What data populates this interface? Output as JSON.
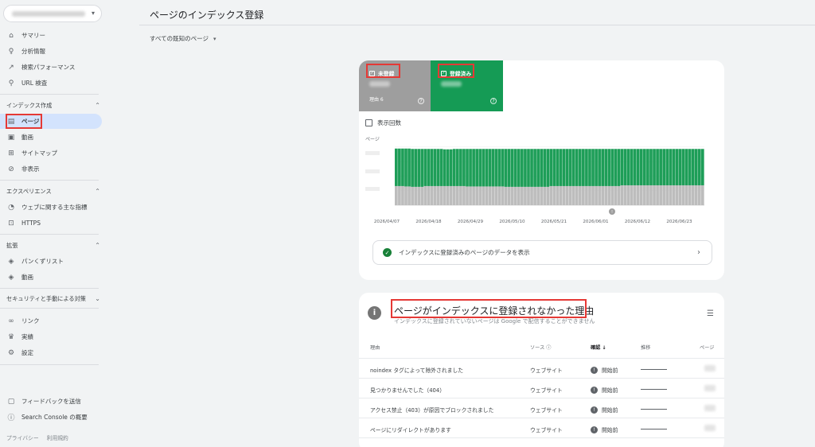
{
  "sidebar": {
    "property_label": "",
    "items_top": [
      {
        "icon": "home-icon",
        "glyph": "⌂",
        "label": "サマリー"
      },
      {
        "icon": "bulb-icon",
        "glyph": "♀",
        "label": "分析情報"
      },
      {
        "icon": "trending-icon",
        "glyph": "↗",
        "label": "検索パフォーマンス"
      },
      {
        "icon": "search-icon",
        "glyph": "⚲",
        "label": "URL 検査"
      }
    ],
    "section_index": {
      "label": "インデックス作成"
    },
    "items_index": [
      {
        "icon": "page-icon",
        "glyph": "▤",
        "label": "ページ",
        "active": true
      },
      {
        "icon": "video-icon",
        "glyph": "▣",
        "label": "動画"
      },
      {
        "icon": "sitemap-icon",
        "glyph": "⊞",
        "label": "サイトマップ"
      },
      {
        "icon": "hidden-icon",
        "glyph": "⊘",
        "label": "非表示"
      }
    ],
    "section_experience": {
      "label": "エクスペリエンス"
    },
    "items_experience": [
      {
        "icon": "gauge-icon",
        "glyph": "◔",
        "label": "ウェブに関する主な指標"
      },
      {
        "icon": "lock-icon",
        "glyph": "⊡",
        "label": "HTTPS"
      }
    ],
    "section_enhance": {
      "label": "拡張"
    },
    "items_enhance": [
      {
        "icon": "layers-icon",
        "glyph": "◈",
        "label": "パンくずリスト"
      },
      {
        "icon": "layers-icon",
        "glyph": "◈",
        "label": "動画"
      }
    ],
    "section_security": {
      "label": "セキュリティと手動による対策"
    },
    "items_misc": [
      {
        "icon": "link-icon",
        "glyph": "∞",
        "label": "リンク"
      },
      {
        "icon": "trophy-icon",
        "glyph": "♛",
        "label": "実績"
      },
      {
        "icon": "gear-icon",
        "glyph": "⚙",
        "label": "設定"
      }
    ],
    "items_bottom": [
      {
        "icon": "feedback-icon",
        "glyph": "▢",
        "label": "フィードバックを送信"
      },
      {
        "icon": "info-icon",
        "glyph": "ⓘ",
        "label": "Search Console の概要"
      }
    ],
    "footer": {
      "privacy": "プライバシー",
      "terms": "利用規約"
    }
  },
  "header": {
    "title": "ページのインデックス登録",
    "filter": "すべての既知のページ"
  },
  "summary": {
    "not_indexed": {
      "label": "未登録",
      "reasons": "理由 6"
    },
    "indexed": {
      "label": "登録済み"
    },
    "impressions_label": "表示回数",
    "chart_ylabel": "ページ",
    "view_indexed": "インデックスに登録済みのページのデータを表示"
  },
  "chart_data": {
    "type": "bar",
    "stacked": true,
    "x": [
      "2026/04/07",
      "2026/04/18",
      "2026/04/29",
      "2026/05/10",
      "2026/05/21",
      "2026/06/01",
      "2026/06/12",
      "2026/06/23"
    ],
    "xlabel": "",
    "ylabel": "ページ",
    "series": [
      {
        "name": "未登録",
        "color": "#bdbdbd",
        "values": [
          0.5,
          0.5,
          0.5,
          0.49,
          0.49,
          0.48,
          0.48,
          0.48,
          0.48,
          0.5,
          0.5,
          0.5,
          0.5,
          0.5,
          0.5,
          0.5,
          0.5,
          0.5,
          0.5,
          0.5,
          0.5,
          0.5,
          0.49,
          0.49,
          0.49,
          0.49,
          0.49,
          0.49,
          0.49,
          0.49,
          0.49,
          0.49,
          0.49,
          0.49,
          0.48,
          0.48,
          0.48,
          0.48,
          0.48,
          0.48,
          0.48,
          0.48,
          0.48,
          0.48,
          0.48,
          0.48,
          0.48,
          0.48,
          0.5,
          0.5,
          0.5,
          0.5,
          0.5,
          0.5,
          0.5,
          0.5,
          0.5,
          0.5,
          0.5,
          0.5,
          0.5,
          0.5,
          0.5,
          0.5,
          0.5,
          0.5,
          0.5,
          0.5,
          0.5,
          0.5,
          0.52,
          0.52,
          0.52,
          0.52,
          0.52,
          0.52,
          0.52,
          0.52,
          0.52,
          0.52,
          0.52,
          0.52,
          0.52,
          0.52,
          0.52,
          0.52,
          0.52,
          0.52,
          0.52,
          0.52,
          0.52,
          0.52,
          0.52,
          0.52,
          0.52,
          0.52
        ]
      },
      {
        "name": "登録済み",
        "color": "#1e9e58",
        "values": [
          0.98,
          0.98,
          0.98,
          0.99,
          0.99,
          0.99,
          0.99,
          0.99,
          0.99,
          0.97,
          0.97,
          0.97,
          0.97,
          0.97,
          0.97,
          0.96,
          0.96,
          0.96,
          0.97,
          0.97,
          0.97,
          0.97,
          0.98,
          0.98,
          0.98,
          0.98,
          0.98,
          0.98,
          0.98,
          0.98,
          0.98,
          0.98,
          0.98,
          0.98,
          0.99,
          0.99,
          0.99,
          0.99,
          0.99,
          0.99,
          0.99,
          0.99,
          0.99,
          0.99,
          0.99,
          0.99,
          0.99,
          0.99,
          0.97,
          0.97,
          0.97,
          0.97,
          0.97,
          0.97,
          0.97,
          0.97,
          0.97,
          0.97,
          0.97,
          0.97,
          0.97,
          0.97,
          0.97,
          0.97,
          0.97,
          0.97,
          0.97,
          0.97,
          0.97,
          0.97,
          0.95,
          0.95,
          0.95,
          0.95,
          0.95,
          0.95,
          0.95,
          0.95,
          0.95,
          0.95,
          0.95,
          0.95,
          0.95,
          0.95,
          0.95,
          0.95,
          0.95,
          0.95,
          0.95,
          0.95,
          0.95,
          0.95,
          0.95,
          0.95,
          0.95,
          0.95
        ]
      }
    ],
    "grid": true
  },
  "reasons": {
    "title": "ページがインデックスに登録されなかった理由",
    "subtitle": "インデックスに登録されていないページは Google で配信することができません",
    "headers": {
      "reason": "理由",
      "source": "ソース",
      "validation": "確認",
      "trend": "推移",
      "pages": "ページ"
    },
    "rows": [
      {
        "reason": "noindex タグによって除外されました",
        "source": "ウェブサイト",
        "status": "開始前"
      },
      {
        "reason": "見つかりませんでした（404）",
        "source": "ウェブサイト",
        "status": "開始前"
      },
      {
        "reason": "アクセス禁止（403）が原因でブロックされました",
        "source": "ウェブサイト",
        "status": "開始前"
      },
      {
        "reason": "ページにリダイレクトがあります",
        "source": "ウェブサイト",
        "status": "開始前"
      }
    ]
  }
}
